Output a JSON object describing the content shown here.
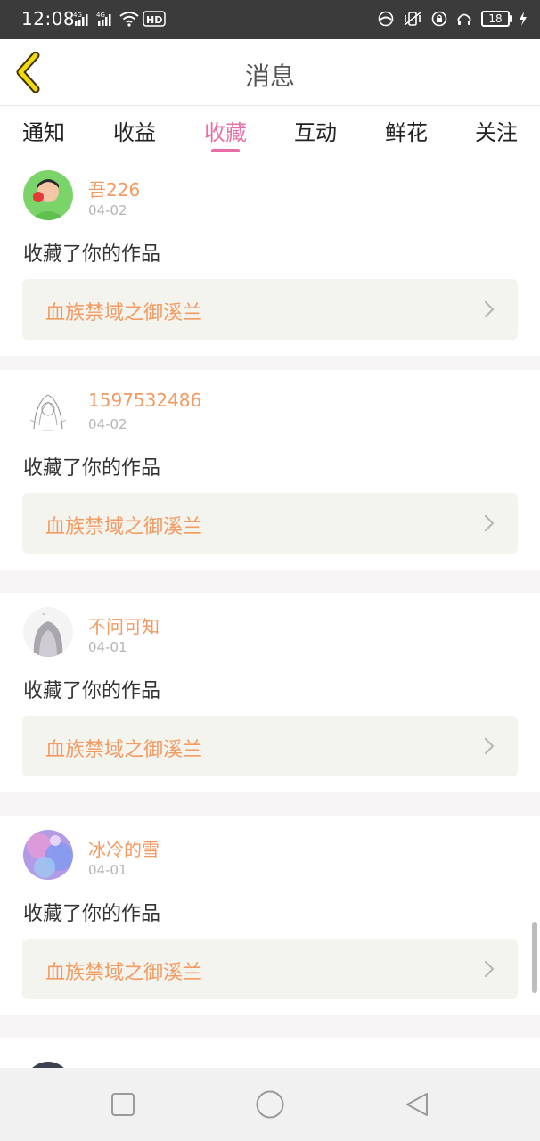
{
  "status_bar": {
    "time": "12:08",
    "network_labels": [
      "4G",
      "4G"
    ],
    "hd_label": "HD",
    "battery": "18",
    "icons": [
      "signal-icon",
      "wifi-icon",
      "hd-icon",
      "camera-icon",
      "vibrate-icon",
      "lock-icon",
      "headset-icon",
      "battery-icon",
      "charging-icon"
    ]
  },
  "header": {
    "title": "消息",
    "back_icon": "chevron-left-icon"
  },
  "tabs": [
    {
      "label": "通知",
      "active": false
    },
    {
      "label": "收益",
      "active": false
    },
    {
      "label": "收藏",
      "active": true
    },
    {
      "label": "互动",
      "active": false
    },
    {
      "label": "鲜花",
      "active": false
    },
    {
      "label": "关注",
      "active": false
    }
  ],
  "messages": [
    {
      "username": "吾226",
      "date": "04-02",
      "action": "收藏了你的作品",
      "work_title": "血族禁域之御溪兰"
    },
    {
      "username": "1597532486",
      "date": "04-02",
      "action": "收藏了你的作品",
      "work_title": "血族禁域之御溪兰"
    },
    {
      "username": "不问可知",
      "date": "04-01",
      "action": "收藏了你的作品",
      "work_title": "血族禁域之御溪兰"
    },
    {
      "username": "冰冷的雪",
      "date": "04-01",
      "action": "收藏了你的作品",
      "work_title": "血族禁域之御溪兰"
    }
  ],
  "nav_bar": {
    "icons": [
      "square-icon",
      "circle-icon",
      "triangle-back-icon"
    ]
  },
  "colors": {
    "accent_pink": "#e86fa5",
    "name_orange": "#f29a62",
    "status_bar_bg": "#3b3b3b",
    "page_bg": "#f6f4f5"
  }
}
